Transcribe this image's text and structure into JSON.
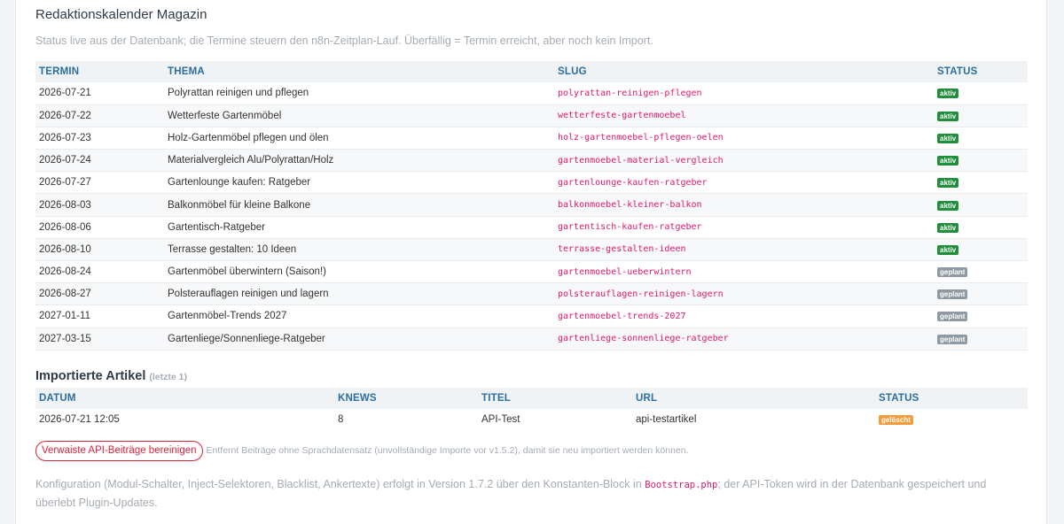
{
  "calendar": {
    "title": "Redaktionskalender Magazin",
    "subtitle": "Status live aus der Datenbank; die Termine steuern den n8n-Zeitplan-Lauf. Überfällig = Termin erreicht, aber noch kein Import.",
    "headers": {
      "termin": "TERMIN",
      "thema": "THEMA",
      "slug": "SLUG",
      "status": "STATUS"
    },
    "rows": [
      {
        "termin": "2026-07-21",
        "thema": "Polyrattan reinigen und pflegen",
        "slug": "polyrattan-reinigen-pflegen",
        "status": "aktiv"
      },
      {
        "termin": "2026-07-22",
        "thema": "Wetterfeste Gartenmöbel",
        "slug": "wetterfeste-gartenmoebel",
        "status": "aktiv"
      },
      {
        "termin": "2026-07-23",
        "thema": "Holz-Gartenmöbel pflegen und ölen",
        "slug": "holz-gartenmoebel-pflegen-oelen",
        "status": "aktiv"
      },
      {
        "termin": "2026-07-24",
        "thema": "Materialvergleich Alu/Polyrattan/Holz",
        "slug": "gartenmoebel-material-vergleich",
        "status": "aktiv"
      },
      {
        "termin": "2026-07-27",
        "thema": "Gartenlounge kaufen: Ratgeber",
        "slug": "gartenlounge-kaufen-ratgeber",
        "status": "aktiv"
      },
      {
        "termin": "2026-08-03",
        "thema": "Balkonmöbel für kleine Balkone",
        "slug": "balkonmoebel-kleiner-balkon",
        "status": "aktiv"
      },
      {
        "termin": "2026-08-06",
        "thema": "Gartentisch-Ratgeber",
        "slug": "gartentisch-kaufen-ratgeber",
        "status": "aktiv"
      },
      {
        "termin": "2026-08-10",
        "thema": "Terrasse gestalten: 10 Ideen",
        "slug": "terrasse-gestalten-ideen",
        "status": "aktiv"
      },
      {
        "termin": "2026-08-24",
        "thema": "Gartenmöbel überwintern (Saison!)",
        "slug": "gartenmoebel-ueberwintern",
        "status": "geplant"
      },
      {
        "termin": "2026-08-27",
        "thema": "Polsterauflagen reinigen und lagern",
        "slug": "polsterauflagen-reinigen-lagern",
        "status": "geplant"
      },
      {
        "termin": "2027-01-11",
        "thema": "Gartenmöbel-Trends 2027",
        "slug": "gartenmoebel-trends-2027",
        "status": "geplant"
      },
      {
        "termin": "2027-03-15",
        "thema": "Gartenliege/Sonnenliege-Ratgeber",
        "slug": "gartenliege-sonnenliege-ratgeber",
        "status": "geplant"
      }
    ]
  },
  "imported": {
    "title": "Importierte Artikel",
    "hint": "(letzte 1)",
    "headers": {
      "datum": "DATUM",
      "knews": "KNEWS",
      "titel": "TITEL",
      "url": "URL",
      "status": "STATUS"
    },
    "rows": [
      {
        "datum": "2026-07-21 12:05",
        "knews": "8",
        "titel": "API-Test",
        "url": "api-testartikel",
        "status": "gelöscht"
      }
    ]
  },
  "cleanup": {
    "button_label": "Verwaiste API-Beiträge bereinigen",
    "hint": "Entfernt Beiträge ohne Sprachdatensatz (unvollständige Importe vor v1.5.2), damit sie neu importiert werden können."
  },
  "footer": {
    "text_before": "Konfiguration (Modul-Schalter, Inject-Selektoren, Blacklist, Ankertexte) erfolgt in Version 1.7.2 über den Konstanten-Block in ",
    "code": "Bootstrap.php",
    "text_after": "; der API-Token wird in der Datenbank gespeichert und überlebt Plugin-Updates."
  },
  "colors": {
    "header_text": "#2b6ea0",
    "slug_text": "#e0196b",
    "badge_aktiv": "#1f8f3c",
    "badge_geplant": "#8f99a3",
    "badge_geloescht": "#f39c3c",
    "danger": "#d9233a"
  }
}
